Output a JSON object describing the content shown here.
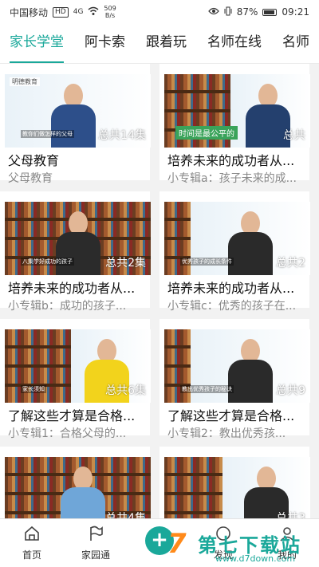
{
  "statusbar": {
    "carrier": "中国移动",
    "hd": "HD",
    "net": "4G",
    "speed_value": "509",
    "speed_unit": "B/s",
    "battery": "87%",
    "time": "09:21"
  },
  "tabs": [
    "家长学堂",
    "阿卡索",
    "跟着玩",
    "名师在线",
    "名师"
  ],
  "active_tab": "家长学堂",
  "cards": [
    {
      "title": "父母教育",
      "subtitle": "父母教育",
      "count": "总共14集",
      "logo": "明德教育",
      "caption": "教你们做怎样的父母"
    },
    {
      "title": "培养未来的成功者从...",
      "subtitle": "小专辑a：孩子未来的成...",
      "count": "总共",
      "banner": "时间是最公平的"
    },
    {
      "title": "培养未来的成功者从...",
      "subtitle": "小专辑b：成功的孩子...",
      "count": "总共2集",
      "caption": "八集学好成功的孩子"
    },
    {
      "title": "培养未来的成功者从...",
      "subtitle": "小专辑c：优秀的孩子在...",
      "count": "总共2",
      "caption": "优秀孩子的成长条件"
    },
    {
      "title": "了解这些才算是合格...",
      "subtitle": "小专辑1：合格父母的...",
      "count": "总共6集",
      "caption": "家长须知"
    },
    {
      "title": "了解这些才算是合格...",
      "subtitle": "小专辑2：教出优秀孩...",
      "count": "总共9",
      "caption": "教出优秀孩子的秘诀"
    },
    {
      "title": "",
      "subtitle": "",
      "count": "总共4集",
      "caption": ""
    },
    {
      "title": "",
      "subtitle": "",
      "count": "总共3",
      "caption": ""
    }
  ],
  "nav": [
    {
      "label": "首页",
      "icon": "home-icon"
    },
    {
      "label": "家园通",
      "icon": "flag-icon"
    },
    {
      "label": "",
      "icon": "plus-icon"
    },
    {
      "label": "发现",
      "icon": "discover-icon"
    },
    {
      "label": "我的",
      "icon": "profile-icon"
    }
  ],
  "watermark": {
    "brand": "第七下载站",
    "url": "www.d7down.com"
  },
  "colors": {
    "accent": "#1aa89a",
    "title": "#111111",
    "subtitle": "#888888",
    "background": "#f2f2f2"
  }
}
